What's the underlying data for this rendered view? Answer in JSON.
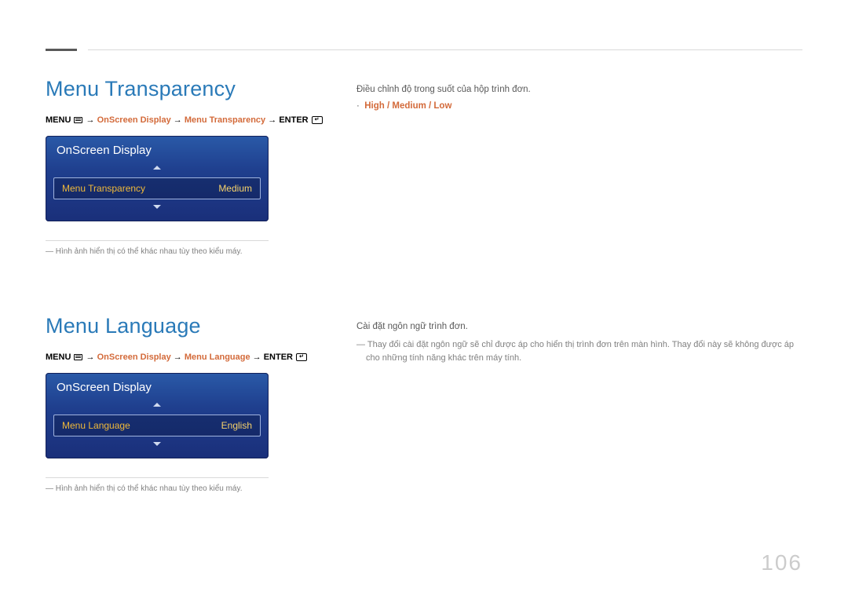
{
  "sections": {
    "transparency": {
      "title": "Menu Transparency",
      "nav": {
        "menu": "MENU",
        "path1": "OnScreen Display",
        "path2": "Menu Transparency",
        "enter": "ENTER"
      },
      "osd": {
        "panel_title": "OnScreen Display",
        "row_label": "Menu Transparency",
        "row_value": "Medium"
      },
      "footnote": "Hình ảnh hiển thị có thể khác nhau tùy theo kiểu máy.",
      "desc": "Điều chỉnh độ trong suốt của hộp trình đơn.",
      "options": "High / Medium / Low"
    },
    "language": {
      "title": "Menu Language",
      "nav": {
        "menu": "MENU",
        "path1": "OnScreen Display",
        "path2": "Menu Language",
        "enter": "ENTER"
      },
      "osd": {
        "panel_title": "OnScreen Display",
        "row_label": "Menu Language",
        "row_value": "English"
      },
      "footnote": "Hình ảnh hiển thị có thể khác nhau tùy theo kiểu máy.",
      "desc": "Cài đặt ngôn ngữ trình đơn.",
      "note": "Thay đổi cài đặt ngôn ngữ sẽ chỉ được áp cho hiển thị trình đơn trên màn hình. Thay đổi này sẽ không được áp cho những tính năng khác trên máy tính."
    }
  },
  "page_number": "106",
  "arrow": "→",
  "bullet_dot": "·"
}
